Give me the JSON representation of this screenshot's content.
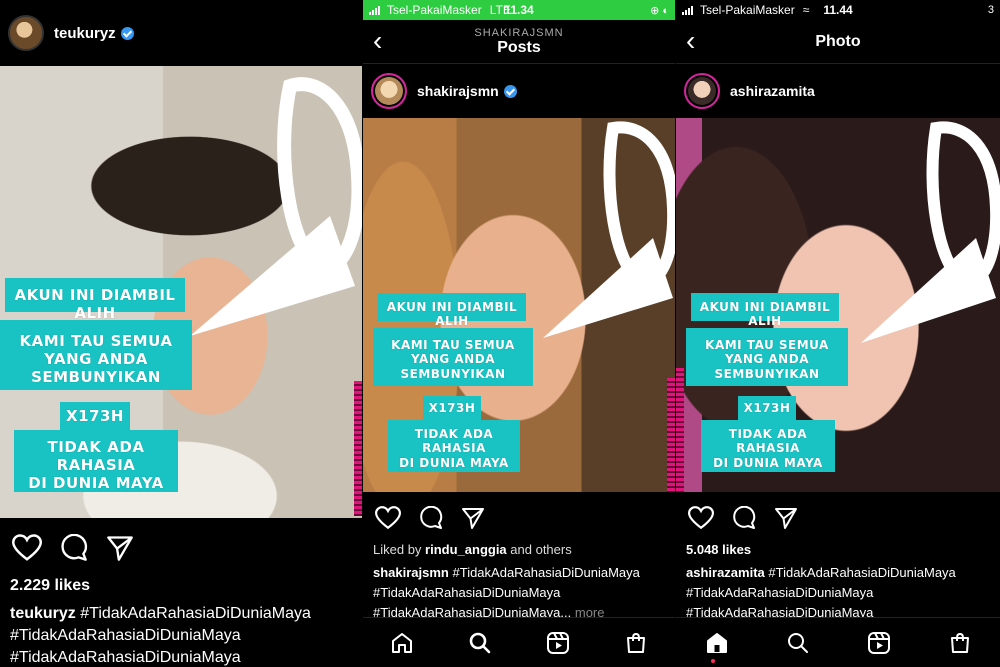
{
  "panel1": {
    "username": "teukuryz",
    "likes": "2.229 likes",
    "caption_user": "teukuryz",
    "caption_lines": [
      "#TidakAdaRahasiaDiDuniaMaya",
      "#TidakAdaRahasiaDiDuniaMaya",
      "#TidakAdaRahasiaDiDuniaMaya"
    ]
  },
  "panel2": {
    "status": {
      "carrier": "Tsel-PakaiMasker",
      "network": "LTE",
      "time": "11.34",
      "right": "⊕ ◐"
    },
    "nav": {
      "subtitle": "SHAKIRAJSMN",
      "title": "Posts"
    },
    "username": "shakirajsmn",
    "liked_by_prefix": "Liked by ",
    "liked_by_user": "rindu_anggia",
    "liked_by_suffix": " and others",
    "caption_user": "shakirajsmn",
    "caption_lines": [
      "#TidakAdaRahasiaDiDuniaMaya",
      "#TidakAdaRahasiaDiDuniaMaya",
      "#TidakAdaRahasiaDiDuniaMaya..."
    ],
    "more": "more"
  },
  "panel3": {
    "status": {
      "carrier": "Tsel-PakaiMasker",
      "time": "11.44",
      "right": "3"
    },
    "nav": {
      "title": "Photo"
    },
    "username": "ashirazamita",
    "likes": "5.048 likes",
    "caption_user": "ashirazamita",
    "caption_lines": [
      "#TidakAdaRahasiaDiDuniaMaya",
      "#TidakAdaRahasiaDiDuniaMaya",
      "#TidakAdaRahasiaDiDuniaMaya"
    ]
  },
  "overlay": {
    "line1": "AKUN INI DIAMBIL ALIH",
    "line2a": "KAMI TAU SEMUA",
    "line2b": "YANG ANDA SEMBUNYIKAN",
    "line3": "X173H",
    "line4a": "TIDAK ADA RAHASIA",
    "line4b": "DI DUNIA MAYA"
  },
  "icons": [
    "heart-icon",
    "comment-icon",
    "share-icon",
    "home-icon",
    "search-icon",
    "reels-icon",
    "shop-icon",
    "back-icon",
    "verified-icon"
  ],
  "colors": {
    "caption_bg": "#19c3c4",
    "verified": "#3897f0",
    "status_green": "#2ecc40",
    "glitch_magenta": "#e0147a"
  }
}
